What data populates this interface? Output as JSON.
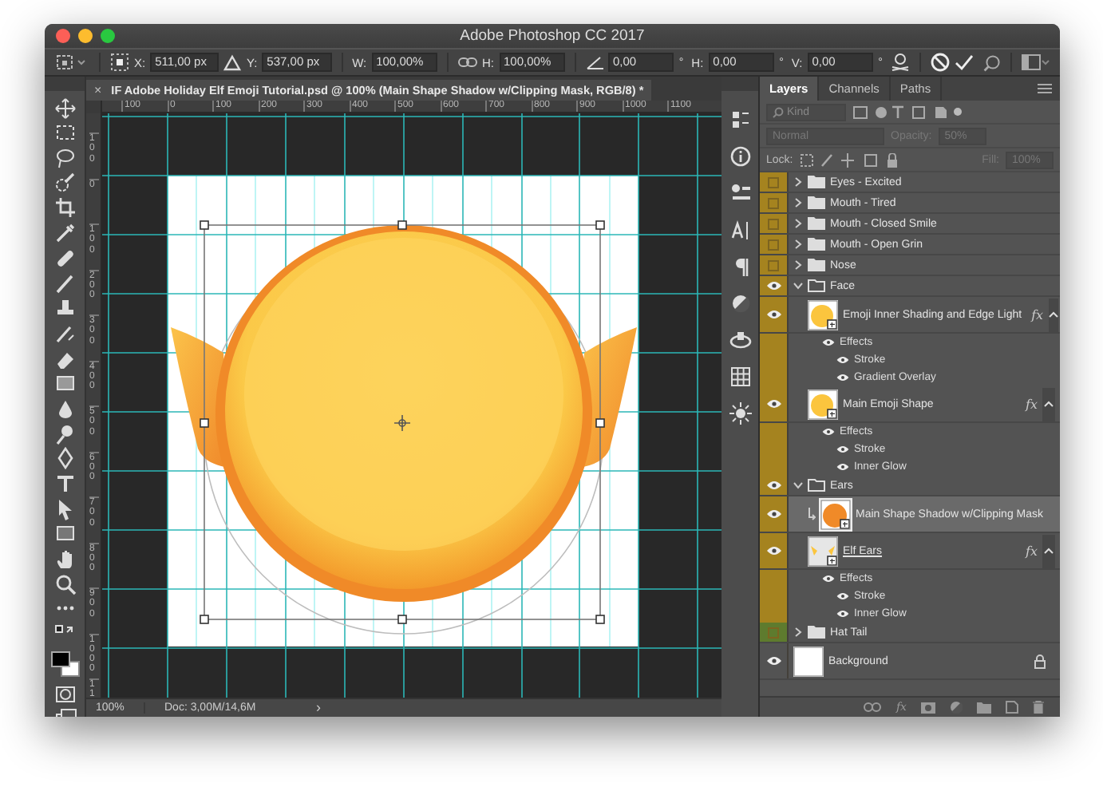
{
  "window": {
    "title": "Adobe Photoshop CC 2017"
  },
  "options_bar": {
    "fields": [
      {
        "kind": "x",
        "label": "X:",
        "value": "511,00 px"
      },
      {
        "kind": "y",
        "label": "Y:",
        "value": "537,00 px"
      },
      {
        "kind": "w",
        "label": "W:",
        "value": "100,00%"
      },
      {
        "kind": "h",
        "label": "H:",
        "value": "100,00%"
      },
      {
        "kind": "angle",
        "value": "0,00",
        "unit": "°"
      },
      {
        "kind": "skew",
        "label": "H:",
        "value": "0,00",
        "unit": "°"
      },
      {
        "kind": "skew",
        "label": "V:",
        "value": "0,00",
        "unit": "°"
      }
    ]
  },
  "document_tab": {
    "close": "×",
    "title": "IF Adobe Holiday Elf Emoji Tutorial.psd @ 100% (Main Shape Shadow w/Clipping Mask, RGB/8) *"
  },
  "rulers": {
    "horizontal": [
      "100",
      "0",
      "100",
      "200",
      "300",
      "400",
      "500",
      "600",
      "700",
      "800",
      "900",
      "1000",
      "1100"
    ],
    "vertical": [
      "100",
      "0",
      "100",
      "200",
      "300",
      "400",
      "500",
      "600",
      "700",
      "800",
      "900",
      "1000",
      "11"
    ]
  },
  "status_bar": {
    "zoom": "100%",
    "doc_info": "Doc: 3,00M/14,6M",
    "arrow": "›"
  },
  "layers_panel": {
    "tabs": [
      {
        "label": "Layers",
        "selected": true
      },
      {
        "label": "Channels",
        "selected": false
      },
      {
        "label": "Paths",
        "selected": false
      }
    ],
    "filter": {
      "placeholder": "Kind"
    },
    "blend_mode": {
      "value": "Normal",
      "disabled": true
    },
    "opacity": {
      "label": "Opacity:",
      "value": "50%",
      "disabled": true
    },
    "lock": {
      "label": "Lock:"
    },
    "fill": {
      "label": "Fill:",
      "value": "100%",
      "disabled": true
    },
    "layers": [
      {
        "kind": "group",
        "name": "Eyes - Excited",
        "visible": false,
        "expanded": false,
        "color": "#a5831f"
      },
      {
        "kind": "group",
        "name": "Mouth - Tired",
        "visible": false,
        "expanded": false,
        "color": "#a5831f"
      },
      {
        "kind": "group",
        "name": "Mouth - Closed Smile",
        "visible": false,
        "expanded": false,
        "color": "#a5831f"
      },
      {
        "kind": "group",
        "name": "Mouth - Open Grin",
        "visible": false,
        "expanded": false,
        "color": "#a5831f"
      },
      {
        "kind": "group",
        "name": "Nose",
        "visible": false,
        "expanded": false,
        "color": "#a5831f"
      },
      {
        "kind": "group",
        "name": "Face",
        "visible": true,
        "expanded": true,
        "color": "#a5831f",
        "children": [
          {
            "kind": "layer",
            "name": "Emoji Inner Shading and Edge Light",
            "visible": true,
            "selected": false,
            "thumbnail": {
              "kind": "yellow"
            },
            "fx": "fx",
            "color": "#a5831f",
            "effects": {
              "label": "Effects",
              "visible": true,
              "items": [
                {
                  "name": "Stroke",
                  "visible": true
                },
                {
                  "name": "Gradient Overlay",
                  "visible": true
                }
              ]
            }
          },
          {
            "kind": "layer",
            "name": "Main Emoji Shape",
            "visible": true,
            "selected": false,
            "thumbnail": {
              "kind": "yellow"
            },
            "fx": "fx",
            "color": "#a5831f",
            "effects": {
              "label": "Effects",
              "visible": true,
              "items": [
                {
                  "name": "Stroke",
                  "visible": true
                },
                {
                  "name": "Inner Glow",
                  "visible": true
                }
              ]
            }
          }
        ]
      },
      {
        "kind": "group",
        "name": "Ears",
        "visible": true,
        "expanded": true,
        "color": "#a5831f",
        "children": [
          {
            "kind": "layer",
            "name": "Main Shape Shadow w/Clipping Mask",
            "visible": true,
            "selected": true,
            "clipped": true,
            "thumbnail": {
              "kind": "orange"
            },
            "color": "#a5831f"
          },
          {
            "kind": "layer",
            "name": "Elf Ears",
            "visible": true,
            "selected": false,
            "clip_base": true,
            "thumbnail": {
              "kind": "ears"
            },
            "fx": "fx",
            "color": "#a5831f",
            "effects": {
              "label": "Effects",
              "visible": true,
              "items": [
                {
                  "name": "Stroke",
                  "visible": true
                },
                {
                  "name": "Inner Glow",
                  "visible": true
                }
              ]
            }
          }
        ]
      },
      {
        "kind": "group",
        "name": "Hat Tail",
        "visible": false,
        "expanded": false,
        "color": "#5e7b2e"
      },
      {
        "kind": "layer",
        "name": "Background",
        "visible": true,
        "selected": false,
        "thumbnail": {
          "kind": "white"
        },
        "locked": true
      }
    ],
    "bottom_bar": {
      "fx_label": "fx"
    }
  }
}
